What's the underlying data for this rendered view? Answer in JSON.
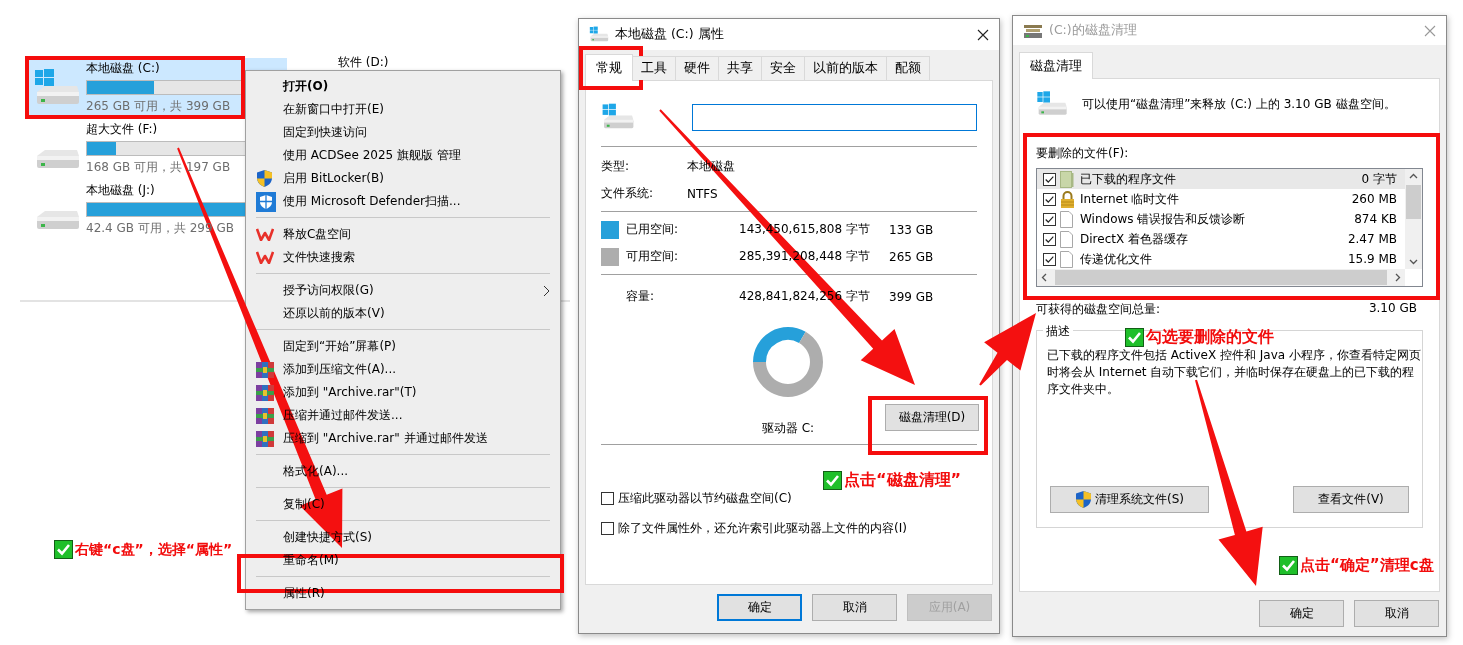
{
  "explorer": {
    "drives": [
      {
        "name": "本地磁盘 (C:)",
        "level": 0.336,
        "info": "265 GB 可用，共 399 GB",
        "selected": true,
        "kind": "system"
      },
      {
        "name": "超大文件 (F:)",
        "level": 0.147,
        "info": "168 GB 可用，共 197 GB",
        "selected": false,
        "kind": "plain"
      },
      {
        "name": "本地磁盘 (J:)",
        "level": 0.858,
        "info": "42.4 GB 可用，共 299 GB",
        "selected": false,
        "kind": "plain"
      }
    ],
    "other_drive": "软件 (D:)"
  },
  "context_menu": {
    "groups": [
      [
        {
          "label": "打开(O)",
          "kind": "plain",
          "default": true,
          "submenu": false
        },
        {
          "label": "在新窗口中打开(E)",
          "kind": "plain",
          "default": false,
          "submenu": false
        },
        {
          "label": "固定到快速访问",
          "kind": "plain",
          "default": false,
          "submenu": false
        },
        {
          "label": "使用 ACDSee 2025 旗舰版 管理",
          "kind": "plain",
          "default": false,
          "submenu": false
        },
        {
          "label": "启用 BitLocker(B)",
          "kind": "shield",
          "default": false,
          "submenu": false
        },
        {
          "label": "使用 Microsoft Defender扫描...",
          "kind": "defender",
          "default": false,
          "submenu": false
        }
      ],
      [
        {
          "label": "释放C盘空间",
          "kind": "wps",
          "default": false,
          "submenu": false
        },
        {
          "label": "文件快速搜索",
          "kind": "wps",
          "default": false,
          "submenu": false
        }
      ],
      [
        {
          "label": "授予访问权限(G)",
          "kind": "plain",
          "default": false,
          "submenu": true
        },
        {
          "label": "还原以前的版本(V)",
          "kind": "plain",
          "default": false,
          "submenu": false
        }
      ],
      [
        {
          "label": "固定到“开始”屏幕(P)",
          "kind": "plain",
          "default": false,
          "submenu": false
        },
        {
          "label": "添加到压缩文件(A)...",
          "kind": "rar",
          "default": false,
          "submenu": false
        },
        {
          "label": "添加到 \"Archive.rar\"(T)",
          "kind": "rar",
          "default": false,
          "submenu": false
        },
        {
          "label": "压缩并通过邮件发送...",
          "kind": "rar",
          "default": false,
          "submenu": false
        },
        {
          "label": "压缩到 \"Archive.rar\" 并通过邮件发送",
          "kind": "rar",
          "default": false,
          "submenu": false
        }
      ],
      [
        {
          "label": "格式化(A)...",
          "kind": "plain",
          "default": false,
          "submenu": false
        }
      ],
      [
        {
          "label": "复制(C)",
          "kind": "plain",
          "default": false,
          "submenu": false
        }
      ],
      [
        {
          "label": "创建快捷方式(S)",
          "kind": "plain",
          "default": false,
          "submenu": false
        },
        {
          "label": "重命名(M)",
          "kind": "plain",
          "default": false,
          "submenu": false
        }
      ],
      [
        {
          "label": "属性(R)",
          "kind": "plain",
          "default": false,
          "submenu": false
        }
      ]
    ]
  },
  "properties_dialog": {
    "title": "本地磁盘 (C:) 属性",
    "tabs": [
      {
        "label": "常规",
        "selected": true
      },
      {
        "label": "工具",
        "selected": false
      },
      {
        "label": "硬件",
        "selected": false
      },
      {
        "label": "共享",
        "selected": false
      },
      {
        "label": "安全",
        "selected": false
      },
      {
        "label": "以前的版本",
        "selected": false
      },
      {
        "label": "配额",
        "selected": false
      }
    ],
    "fields": [
      {
        "label": "类型:",
        "value": "本地磁盘"
      },
      {
        "label": "文件系统:",
        "value": "NTFS"
      }
    ],
    "spaces": [
      {
        "label": "已用空间:",
        "bytes": "143,450,615,808 字节",
        "size": "133 GB",
        "color": "#26a0da"
      },
      {
        "label": "可用空间:",
        "bytes": "285,391,208,448 字节",
        "size": "265 GB",
        "color": "#adadad"
      }
    ],
    "capacity": {
      "label": "容量:",
      "bytes": "428,841,824,256 字节",
      "size": "399 GB"
    },
    "chart_data": {
      "type": "donut",
      "values": [
        33.4,
        66.6
      ]
    },
    "drive_label": "驱动器 C:",
    "cleanup_button": "磁盘清理(D)",
    "options": [
      {
        "label": "压缩此驱动器以节约磁盘空间(C)",
        "checked": false
      },
      {
        "label": "除了文件属性外，还允许索引此驱动器上文件的内容(I)",
        "checked": false
      }
    ],
    "buttons": [
      {
        "label": "确定",
        "default": true,
        "disabled": false
      },
      {
        "label": "取消",
        "default": false,
        "disabled": false
      },
      {
        "label": "应用(A)",
        "default": false,
        "disabled": true
      }
    ]
  },
  "cleanup_dialog": {
    "title": "(C:)的磁盘清理",
    "active": false,
    "tabs": [
      {
        "label": "磁盘清理",
        "selected": true
      }
    ],
    "intro": "可以使用“磁盘清理”来释放  (C:) 上的 3.10 GB 磁盘空间。",
    "files_label": "要删除的文件(F):",
    "files": [
      {
        "name": "已下载的程序文件",
        "size": "0 字节",
        "checked": true,
        "selected": true,
        "kind": "folder"
      },
      {
        "name": "Internet 临时文件",
        "size": "260 MB",
        "checked": true,
        "selected": false,
        "kind": "lock"
      },
      {
        "name": "Windows 错误报告和反馈诊断",
        "size": "874 KB",
        "checked": true,
        "selected": false,
        "kind": "file"
      },
      {
        "name": "DirectX 着色器缓存",
        "size": "2.47 MB",
        "checked": true,
        "selected": false,
        "kind": "file"
      },
      {
        "name": "传递优化文件",
        "size": "15.9 MB",
        "checked": true,
        "selected": false,
        "kind": "file"
      }
    ],
    "total_label": "可获得的磁盘空间总量:",
    "total": "3.10 GB",
    "description_label": "描述",
    "description": "已下载的程序文件包括 ActiveX 控件和 Java 小程序，你查看特定网页时将会从 Internet 自动下载它们，并临时保存在硬盘上的已下载的程序文件夹中。",
    "actions": [
      {
        "label": "清理系统文件(S)",
        "kind": "shield"
      },
      {
        "label": "查看文件(V)",
        "kind": "plain"
      }
    ],
    "buttons": [
      {
        "label": "确定"
      },
      {
        "label": "取消"
      }
    ]
  },
  "annotations": [
    {
      "text": "右键“c盘”，选择“属性”"
    },
    {
      "text": "点击“磁盘清理”"
    },
    {
      "text": "勾选要删除的文件"
    },
    {
      "text": "点击“确定”清理c盘"
    }
  ]
}
